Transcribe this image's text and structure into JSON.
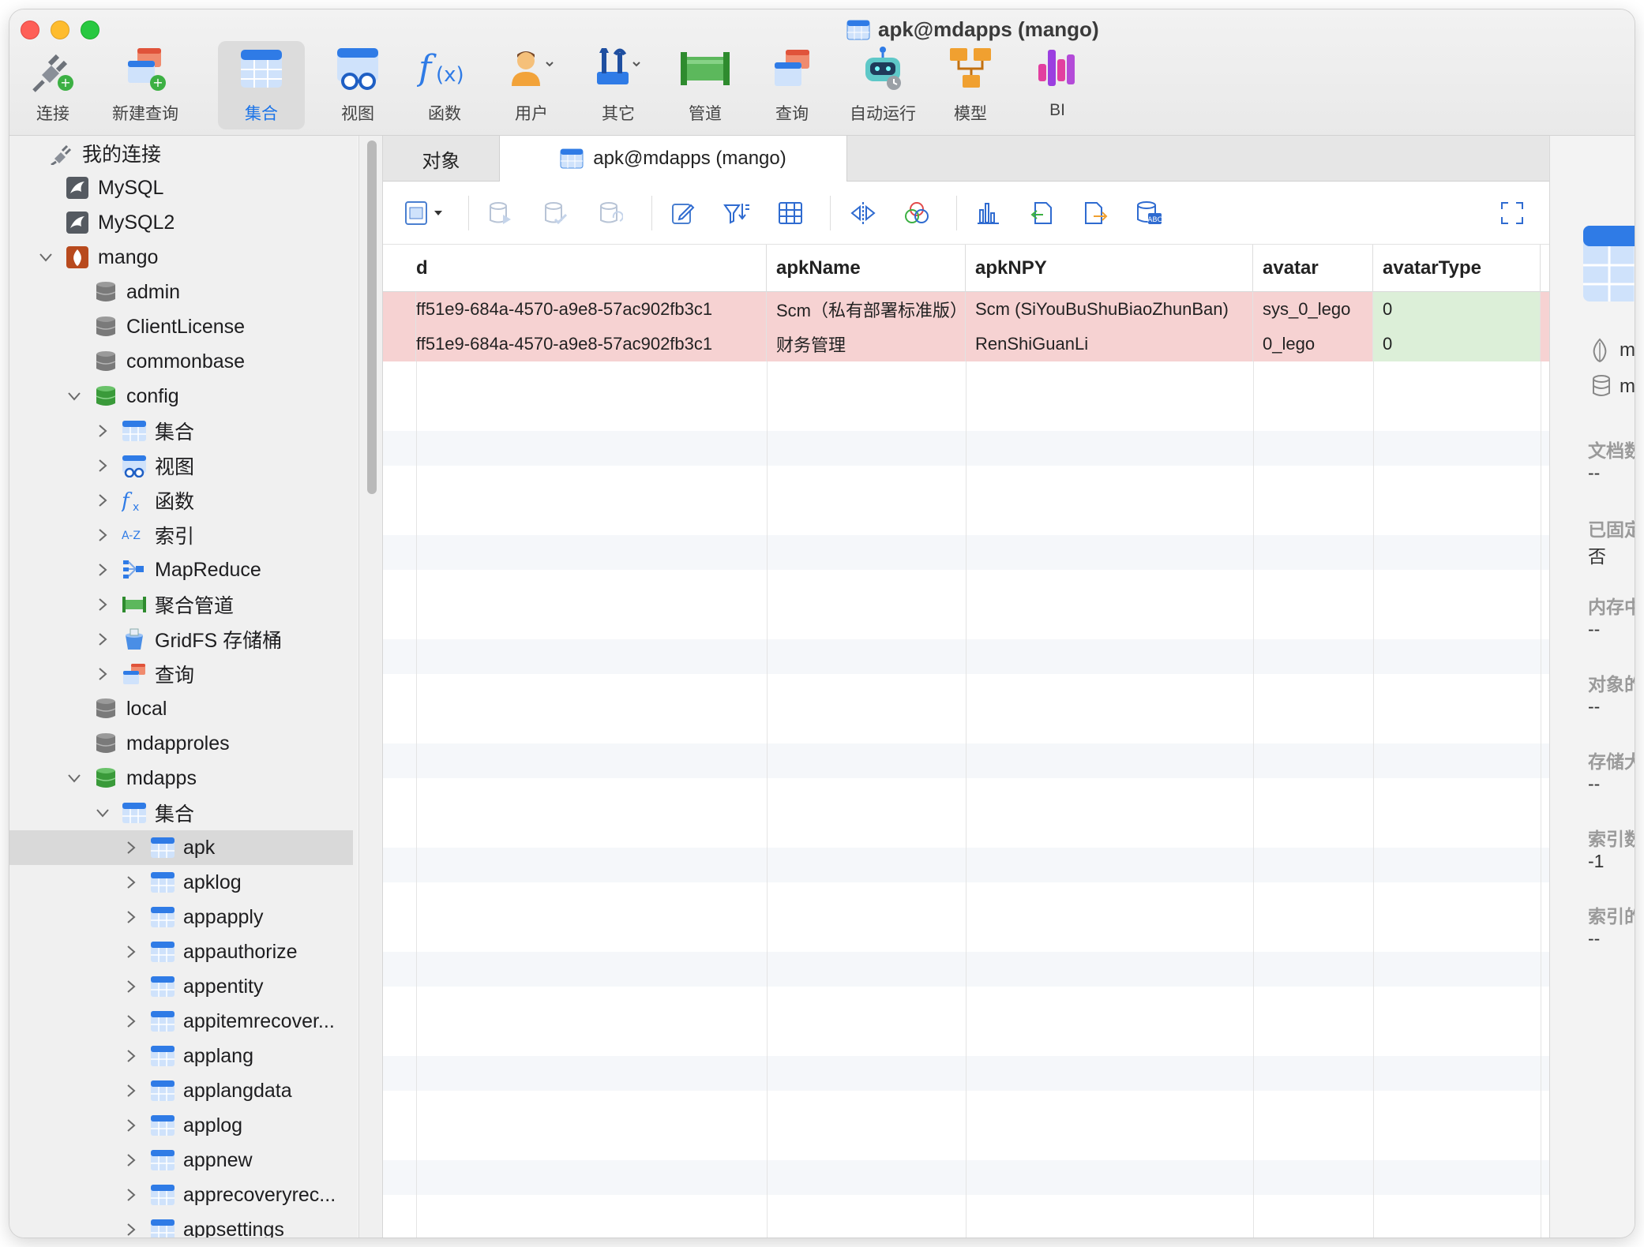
{
  "window": {
    "title": "apk@mdapps (mango)"
  },
  "toolbar": {
    "items": [
      {
        "label": "连接",
        "icon": "connect-plug-icon"
      },
      {
        "label": "新建查询",
        "icon": "new-query-icon"
      },
      {
        "label": "集合",
        "icon": "collection-icon",
        "active": true
      },
      {
        "label": "视图",
        "icon": "view-icon"
      },
      {
        "label": "函数",
        "icon": "function-icon"
      },
      {
        "label": "用户",
        "icon": "user-icon"
      },
      {
        "label": "其它",
        "icon": "tools-icon"
      },
      {
        "label": "管道",
        "icon": "pipeline-icon"
      },
      {
        "label": "查询",
        "icon": "query-icon"
      },
      {
        "label": "自动运行",
        "icon": "robot-icon"
      },
      {
        "label": "模型",
        "icon": "model-icon"
      },
      {
        "label": "BI",
        "icon": "bi-icon"
      }
    ]
  },
  "sidebar": {
    "items": [
      {
        "label": "我的连接",
        "icon": "connections-icon",
        "level": 0
      },
      {
        "label": "MySQL",
        "icon": "mysql-icon",
        "level": 1
      },
      {
        "label": "MySQL2",
        "icon": "mysql-icon",
        "level": 1
      },
      {
        "label": "mango",
        "icon": "mongodb-leaf-icon",
        "level": 1,
        "expanded": true
      },
      {
        "label": "admin",
        "icon": "database-gray-icon",
        "level": 2
      },
      {
        "label": "ClientLicense",
        "icon": "database-gray-icon",
        "level": 2
      },
      {
        "label": "commonbase",
        "icon": "database-gray-icon",
        "level": 2
      },
      {
        "label": "config",
        "icon": "database-green-icon",
        "level": 2,
        "expanded": true
      },
      {
        "label": "集合",
        "icon": "collection-icon",
        "level": 3,
        "collapsed": true
      },
      {
        "label": "视图",
        "icon": "view-icon",
        "level": 3,
        "collapsed": true
      },
      {
        "label": "函数",
        "icon": "function-icon",
        "level": 3,
        "collapsed": true
      },
      {
        "label": "索引",
        "icon": "index-az-icon",
        "level": 3,
        "collapsed": true
      },
      {
        "label": "MapReduce",
        "icon": "mapreduce-icon",
        "level": 3,
        "collapsed": true
      },
      {
        "label": "聚合管道",
        "icon": "pipeline-icon",
        "level": 3,
        "collapsed": true
      },
      {
        "label": "GridFS 存储桶",
        "icon": "bucket-icon",
        "level": 3,
        "collapsed": true
      },
      {
        "label": "查询",
        "icon": "query-icon",
        "level": 3,
        "collapsed": true
      },
      {
        "label": "local",
        "icon": "database-gray-icon",
        "level": 2
      },
      {
        "label": "mdapproles",
        "icon": "database-gray-icon",
        "level": 2
      },
      {
        "label": "mdapps",
        "icon": "database-green-icon",
        "level": 2,
        "expanded": true
      },
      {
        "label": "集合",
        "icon": "collection-icon",
        "level": 3,
        "expanded": true
      },
      {
        "label": "apk",
        "icon": "collection-icon",
        "level": 4,
        "collapsed": true,
        "selected": true
      },
      {
        "label": "apklog",
        "icon": "collection-icon",
        "level": 4,
        "collapsed": true
      },
      {
        "label": "appapply",
        "icon": "collection-icon",
        "level": 4,
        "collapsed": true
      },
      {
        "label": "appauthorize",
        "icon": "collection-icon",
        "level": 4,
        "collapsed": true
      },
      {
        "label": "appentity",
        "icon": "collection-icon",
        "level": 4,
        "collapsed": true
      },
      {
        "label": "appitemrecover...",
        "icon": "collection-icon",
        "level": 4,
        "collapsed": true
      },
      {
        "label": "applang",
        "icon": "collection-icon",
        "level": 4,
        "collapsed": true
      },
      {
        "label": "applangdata",
        "icon": "collection-icon",
        "level": 4,
        "collapsed": true
      },
      {
        "label": "applog",
        "icon": "collection-icon",
        "level": 4,
        "collapsed": true
      },
      {
        "label": "appnew",
        "icon": "collection-icon",
        "level": 4,
        "collapsed": true
      },
      {
        "label": "apprecoveryrec...",
        "icon": "collection-icon",
        "level": 4,
        "collapsed": true
      },
      {
        "label": "appsettings",
        "icon": "collection-icon",
        "level": 4,
        "collapsed": true
      }
    ]
  },
  "tabs": {
    "objects": "对象",
    "active": "apk@mdapps (mango)"
  },
  "grid": {
    "columns": [
      "d",
      "apkName",
      "apkNPY",
      "avatar",
      "avatarType"
    ],
    "rows": [
      [
        "ff51e9-684a-4570-a9e8-57ac902fb3c1",
        "Scm（私有部署标准版）",
        "Scm (SiYouBuShuBiaoZhunBan)",
        "sys_0_lego",
        "0"
      ],
      [
        "ff51e9-684a-4570-a9e8-57ac902fb3c1",
        "财务管理",
        "RenShiGuanLi",
        "0_lego",
        "0"
      ]
    ]
  },
  "right_panel": {
    "conn_host": "ma",
    "conn_db": "mo",
    "fields": [
      {
        "label": "文档数",
        "value": "--"
      },
      {
        "label": "已固定",
        "value": "否"
      },
      {
        "label": "内存中",
        "value": "--"
      },
      {
        "label": "对象的",
        "value": "--"
      },
      {
        "label": "存储大",
        "value": "--"
      },
      {
        "label": "索引数",
        "value": "-1"
      },
      {
        "label": "索引的",
        "value": "--"
      }
    ]
  },
  "colors": {
    "accent": "#1a73e8",
    "deleted_row": "#f6d2d2",
    "ok_cell": "#dcefd8"
  }
}
